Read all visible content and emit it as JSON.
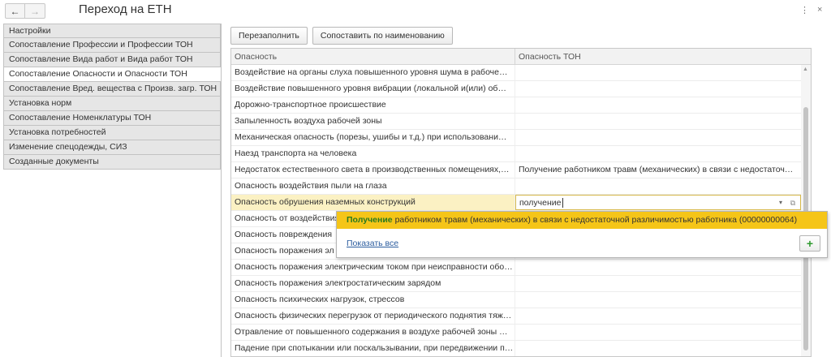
{
  "window": {
    "title": "Переход на ЕТН",
    "back_icon": "←",
    "forward_icon": "→",
    "menu_icon": "⋮",
    "close_icon": "×"
  },
  "sidebar": {
    "items": [
      {
        "label": "Настройки"
      },
      {
        "label": "Сопоставление Профессии и Профессии ТОН"
      },
      {
        "label": "Сопоставление Вида работ и Вида работ ТОН"
      },
      {
        "label": "Сопоставление Опасности и Опасности ТОН"
      },
      {
        "label": "Сопоставление Вред. вещества с Произв. загр. ТОН"
      },
      {
        "label": "Установка норм"
      },
      {
        "label": "Сопоставление Номенклатуры ТОН"
      },
      {
        "label": "Установка потребностей"
      },
      {
        "label": "Изменение спецодежды, СИЗ"
      },
      {
        "label": "Созданные документы"
      }
    ],
    "active_index": 3
  },
  "toolbar": {
    "refill_label": "Перезаполнить",
    "match_by_name_label": "Сопоставить по наименованию"
  },
  "table": {
    "columns": [
      "Опасность",
      "Опасность ТОН"
    ],
    "rows": [
      [
        "Воздействие на органы слуха повышенного уровня шума в рабоче…",
        ""
      ],
      [
        "Воздействие повышенного уровня вибрации (локальной и(или) об…",
        ""
      ],
      [
        "Дорожно-транспортное происшествие",
        ""
      ],
      [
        "Запыленность воздуха рабочей зоны",
        ""
      ],
      [
        "Механическая опасность (порезы, ушибы и т.д.) при использовани…",
        ""
      ],
      [
        "Наезд транспорта на человека",
        ""
      ],
      [
        "Недостаток естественного света в производственных помещениях,…",
        "Получение работником травм (механических) в связи с недостаточ…"
      ],
      [
        "Опасность воздействия пыли на глаза",
        ""
      ],
      [
        "Опасность обрушения наземных конструкций",
        "получение"
      ],
      [
        "Опасность от воздействия",
        ""
      ],
      [
        "Опасность повреждения",
        ""
      ],
      [
        "Опасность поражения эл",
        ""
      ],
      [
        "Опасность поражения электрическим током при неисправности обо…",
        ""
      ],
      [
        "Опасность поражения электростатическим зарядом",
        ""
      ],
      [
        "Опасность психических нагрузок, стрессов",
        ""
      ],
      [
        "Опасность физических перегрузок от периодического поднятия тяж…",
        ""
      ],
      [
        "Отравление от повышенного содержания в воздухе рабочей зоны …",
        ""
      ],
      [
        "Падение при спотыкании или поскальзывании, при передвижении п…",
        ""
      ]
    ],
    "selected_index": 8
  },
  "popup": {
    "match_text": "Получение",
    "rest_text": " работником травм (механических) в связи с недостаточной различимостью работника (00000000064)",
    "show_all_label": "Показать все",
    "add_icon": "+"
  },
  "colors": {
    "highlight_yellow": "#f5c518",
    "selected_row": "#fbf1c3",
    "match_green": "#2a7a1e",
    "link_blue": "#2b5c9e"
  }
}
